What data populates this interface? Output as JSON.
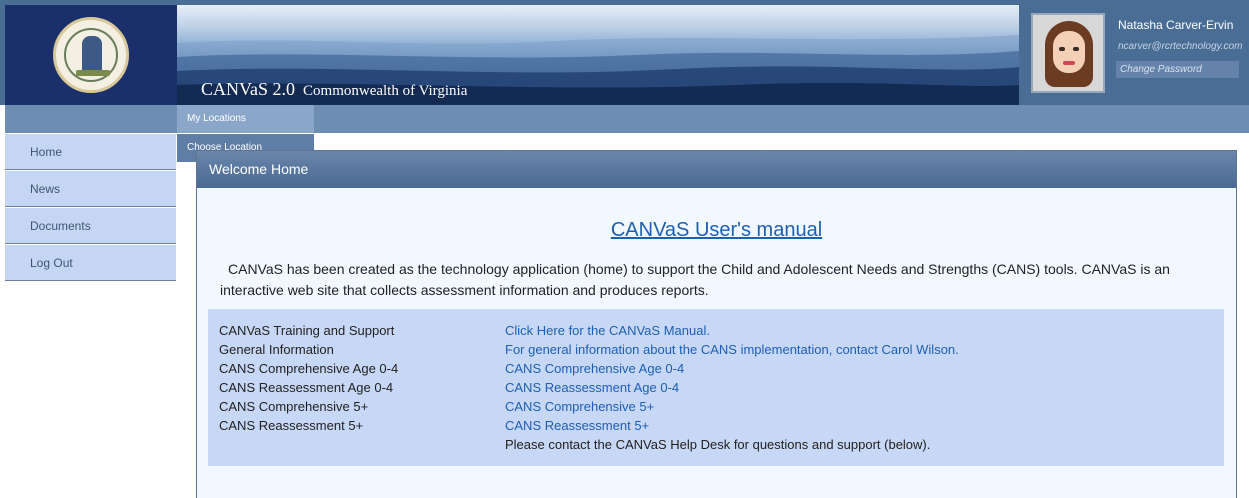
{
  "header": {
    "app_name": "CANVaS 2.0",
    "org_name": "Commonwealth of Virginia",
    "colors": {
      "header_bg": "#4a6d96",
      "seal_bg": "#1b2f6b"
    }
  },
  "user": {
    "name": "Natasha Carver-Ervin",
    "email": "ncarver@rcrtechnology.com",
    "change_password": "Change Password"
  },
  "nav": {
    "dropdown": [
      {
        "label": "My Locations"
      },
      {
        "label": "Choose Location"
      }
    ]
  },
  "sidebar": {
    "items": [
      {
        "label": "Home"
      },
      {
        "label": "News"
      },
      {
        "label": "Documents"
      },
      {
        "label": "Log Out"
      }
    ]
  },
  "main": {
    "panel_title": "Welcome Home",
    "manual_link": "CANVaS User's manual",
    "intro": "CANVaS has been created as the technology application (home) to support the Child and Adolescent Needs and Strengths (CANS) tools. CANVaS is an interactive web site that collects assessment information and produces reports.",
    "rows": [
      {
        "label": "CANVaS Training and Support",
        "link": "Click Here for the CANVaS Manual."
      },
      {
        "label": "General Information",
        "link": "For general information about the CANS implementation, contact Carol Wilson."
      },
      {
        "label": "CANS Comprehensive Age 0-4",
        "link": "CANS Comprehensive Age 0-4"
      },
      {
        "label": "CANS Reassessment Age 0-4",
        "link": "CANS Reassessment Age 0-4"
      },
      {
        "label": "CANS Comprehensive 5+",
        "link": "CANS Comprehensive 5+"
      },
      {
        "label": "CANS Reassessment 5+",
        "link": "CANS Reassessment 5+"
      }
    ],
    "help_note": "Please contact the CANVaS Help Desk for questions and support (below).",
    "link_color": "#1e5fb3"
  }
}
